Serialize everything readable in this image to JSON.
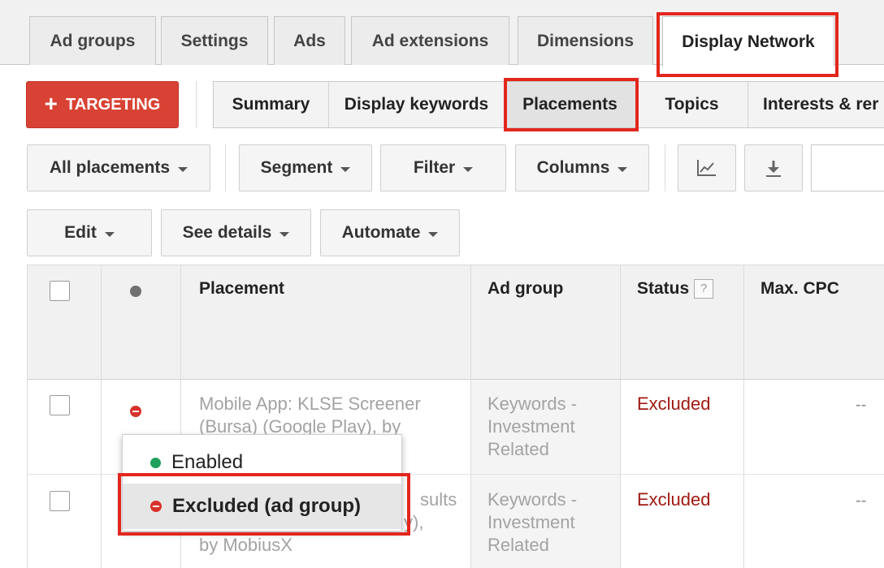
{
  "tabs": [
    {
      "label": "Ad groups"
    },
    {
      "label": "Settings"
    },
    {
      "label": "Ads"
    },
    {
      "label": "Ad extensions"
    },
    {
      "label": "Dimensions"
    },
    {
      "label": "Display Network",
      "active": true
    }
  ],
  "targeting_button": {
    "label": "TARGETING",
    "icon": "plus-icon"
  },
  "subtabs": [
    {
      "label": "Summary"
    },
    {
      "label": "Display keywords"
    },
    {
      "label": "Placements",
      "active": true
    },
    {
      "label": "Topics"
    },
    {
      "label": "Interests & rer"
    }
  ],
  "toolbar": {
    "all_placements": "All placements",
    "segment": "Segment",
    "filter": "Filter",
    "columns": "Columns",
    "chart_icon": "line-chart-icon",
    "download_icon": "download-icon"
  },
  "actions": {
    "edit": "Edit",
    "see_details": "See details",
    "automate": "Automate"
  },
  "table": {
    "headers": {
      "placement": "Placement",
      "ad_group": "Ad group",
      "status": "Status",
      "status_help": "?",
      "max_cpc": "Max. CPC"
    },
    "rows": [
      {
        "placement_line1": "Mobile App: KLSE Screener",
        "placement_line2": "(Bursa) (Google Play), by",
        "ad_group_line1": "Keywords -",
        "ad_group_line2": "Investment",
        "ad_group_line3": "Related",
        "status": "Excluded",
        "max_cpc": "--"
      },
      {
        "placement_line1": "sults",
        "placement_line2": "y),",
        "placement_line3": "by MobiusX",
        "ad_group_line1": "Keywords -",
        "ad_group_line2": "Investment",
        "ad_group_line3": "Related",
        "status": "Excluded",
        "max_cpc": "--"
      }
    ]
  },
  "status_dropdown": {
    "options": [
      {
        "label": "Enabled",
        "color": "#1fa05a"
      },
      {
        "label": "Excluded (ad group)",
        "color": "#d8322a",
        "selected": true
      }
    ]
  },
  "colors": {
    "highlight": "#e3261d",
    "targeting": "#d84234",
    "excluded_text": "#a01a12"
  }
}
